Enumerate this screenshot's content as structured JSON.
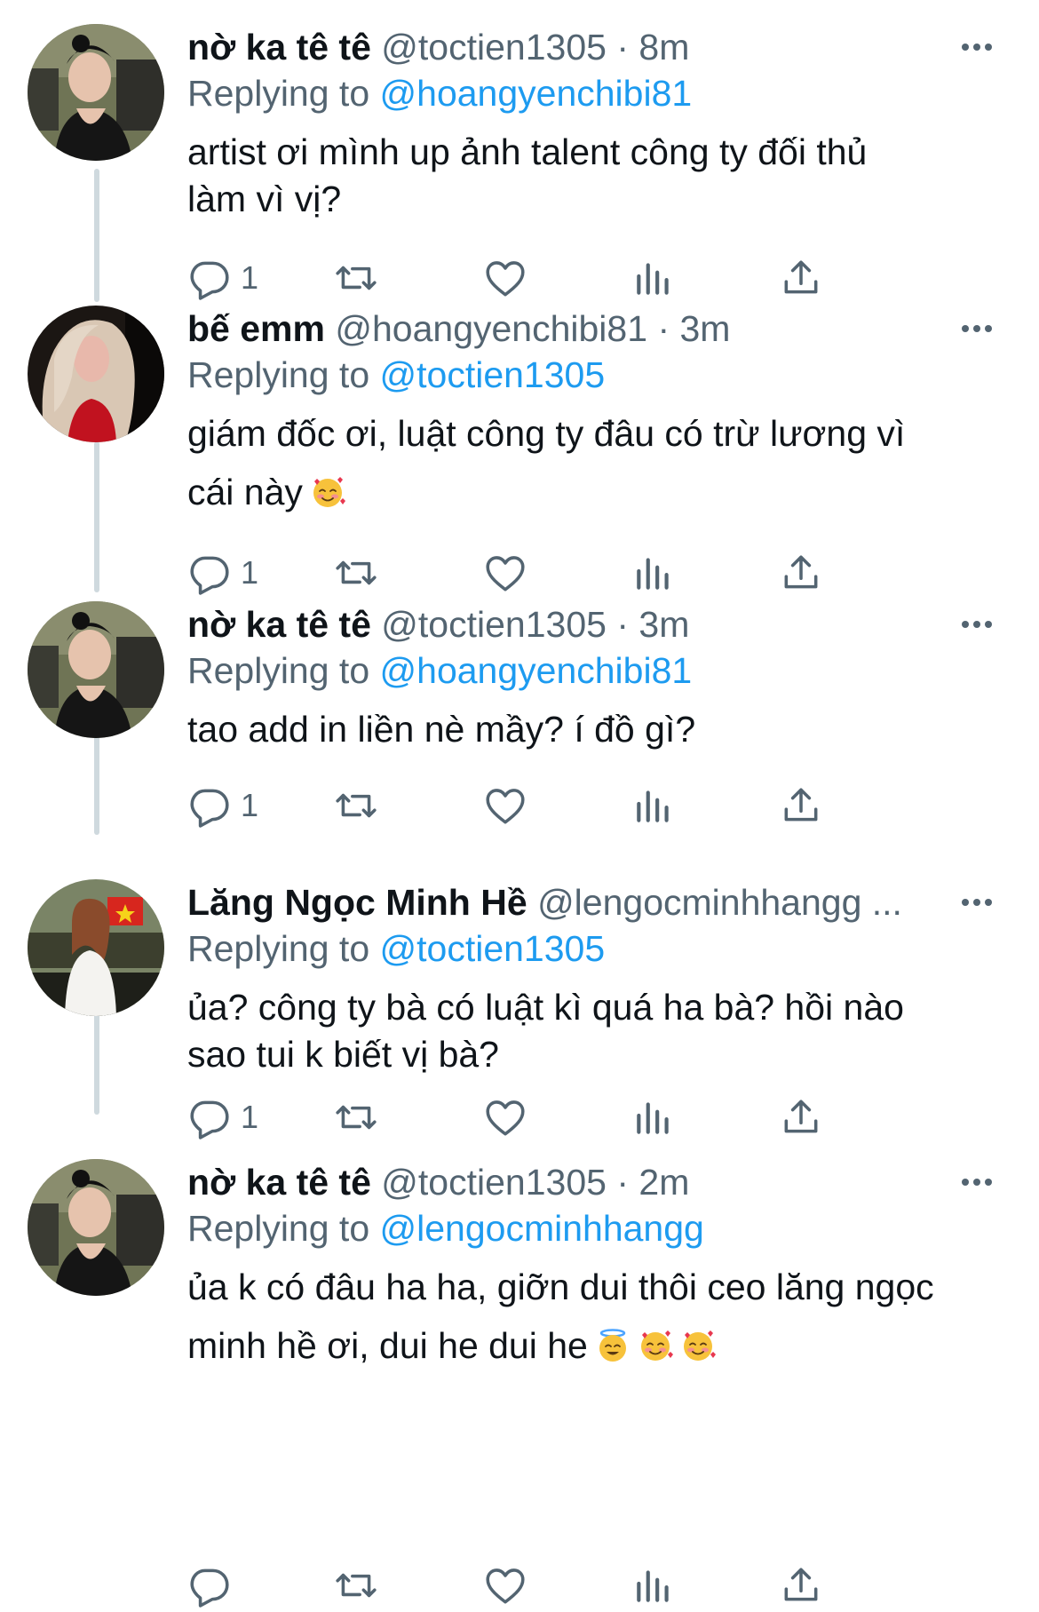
{
  "tweets": [
    {
      "name": "nờ ka tê tê",
      "handle": "@toctien1305",
      "time": "8m",
      "reply_prefix": "Replying to ",
      "reply_to": "@hoangyenchibi81",
      "text": "artist ơi mình up ảnh talent công ty đối thủ\nlàm vì vị?",
      "reply_count": "1"
    },
    {
      "name": "bế emm",
      "handle": "@hoangyenchibi81",
      "time": "3m",
      "reply_prefix": "Replying to ",
      "reply_to": "@toctien1305",
      "text": "giám đốc ơi, luật công ty đâu có trừ lương vì\ncái này",
      "emojis": [
        "smiling-face-with-hearts"
      ],
      "reply_count": "1"
    },
    {
      "name": "nờ ka tê tê",
      "handle": "@toctien1305",
      "time": "3m",
      "reply_prefix": "Replying to ",
      "reply_to": "@hoangyenchibi81",
      "text": "tao add in liền nè mầy? í đồ gì?",
      "reply_count": "1"
    },
    {
      "name": "Lăng Ngọc Minh Hề",
      "handle": "@lengocminhhangg ...",
      "reply_prefix": "Replying to ",
      "reply_to": "@toctien1305",
      "text": "ủa? công ty bà có luật kì quá ha bà? hồi nào\nsao tui k biết vị bà?",
      "reply_count": "1"
    },
    {
      "name": "nờ ka tê tê",
      "handle": "@toctien1305",
      "time": "2m",
      "reply_prefix": "Replying to ",
      "reply_to": "@lengocminhhangg",
      "text": "ủa k có đâu ha ha, giỡn dui thôi ceo lăng ngọc\nminh hề ơi, dui he dui he",
      "emojis": [
        "smiling-face-with-halo",
        "smiling-face-with-hearts",
        "smiling-face-with-hearts"
      ],
      "reply_count": ""
    }
  ],
  "time_separator": "·",
  "icons": {
    "reply": "reply-icon",
    "retweet": "retweet-icon",
    "like": "heart-icon",
    "views": "views-icon",
    "share": "share-icon",
    "more": "more-icon"
  },
  "colors": {
    "link": "#1d9bf0",
    "secondary": "#536471",
    "thread_line": "#cfd9de"
  }
}
